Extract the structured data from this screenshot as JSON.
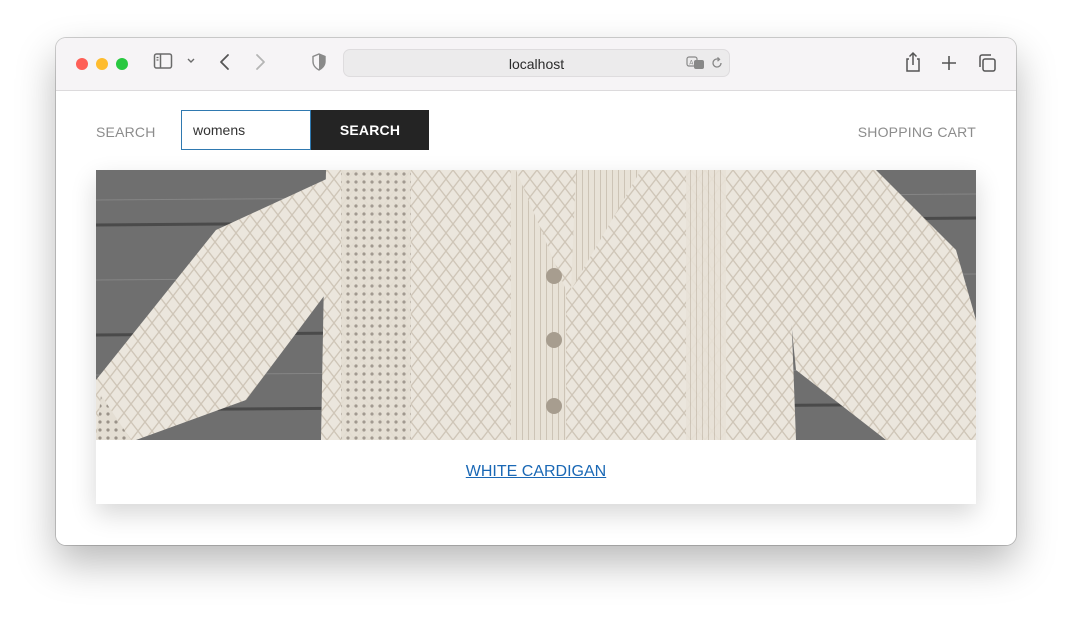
{
  "browser": {
    "address": "localhost",
    "icons": [
      "sidebar-icon",
      "chevron-down-icon",
      "back-icon",
      "forward-icon",
      "shield-icon",
      "translate-icon",
      "reload-icon",
      "share-icon",
      "plus-icon",
      "tabs-icon"
    ]
  },
  "header": {
    "search_label": "SEARCH",
    "search_value": "womens",
    "search_button": "SEARCH",
    "cart_label": "SHOPPING CART"
  },
  "product": {
    "name": "WHITE CARDIGAN",
    "image_alt": "white cable-knit cardigan on wooden boards",
    "link_color": "#1a68b5"
  },
  "colors": {
    "button_bg": "#242424",
    "input_border": "#2f79b0",
    "muted_text": "#8c8c8c"
  }
}
